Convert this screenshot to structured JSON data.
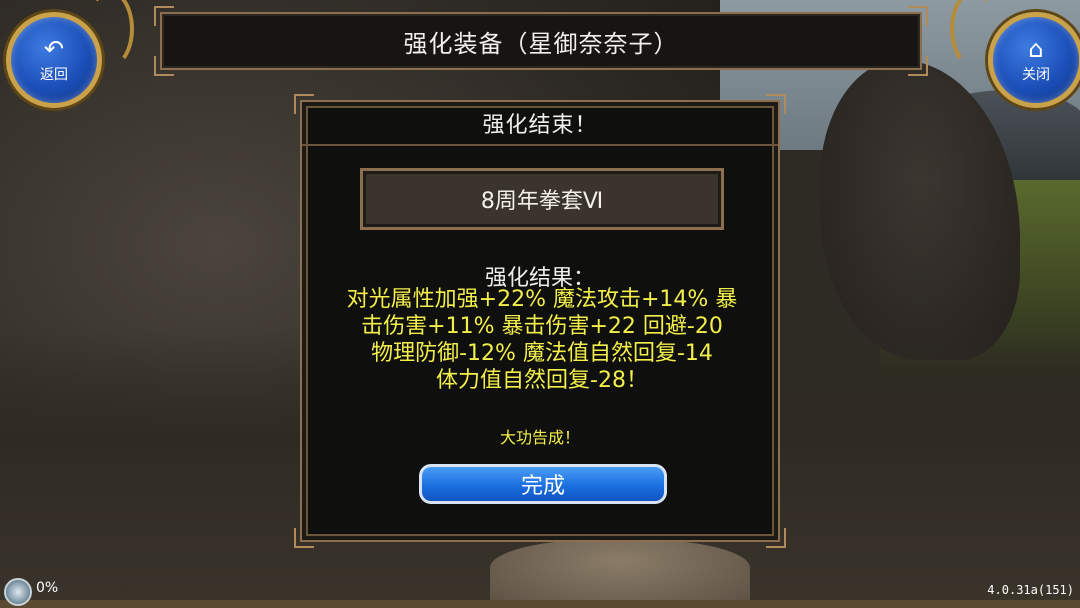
{
  "header": {
    "back_label": "返回",
    "back_icon": "back-arrow-icon",
    "title": "强化装备（星御奈奈子）",
    "close_label": "关闭",
    "close_icon": "home-icon"
  },
  "dialog": {
    "title": "强化结束！",
    "item_name": "8周年拳套Ⅵ",
    "result_heading": "强化结果：",
    "result_lines": [
      "对光属性加强+22% 魔法攻击+14% 暴",
      "击伤害+11% 暴击伤害+22 回避-20",
      "物理防御-12% 魔法值自然回复-14",
      "体力值自然回复-28！"
    ],
    "success_text": "大功告成！",
    "done_label": "完成"
  },
  "status": {
    "progress_text": "0%",
    "version": "4.0.31a(151)"
  },
  "colors": {
    "highlight_text": "#f2ee4a",
    "button_blue": "#1c6fe0",
    "frame_gold": "#8b6f4e"
  }
}
